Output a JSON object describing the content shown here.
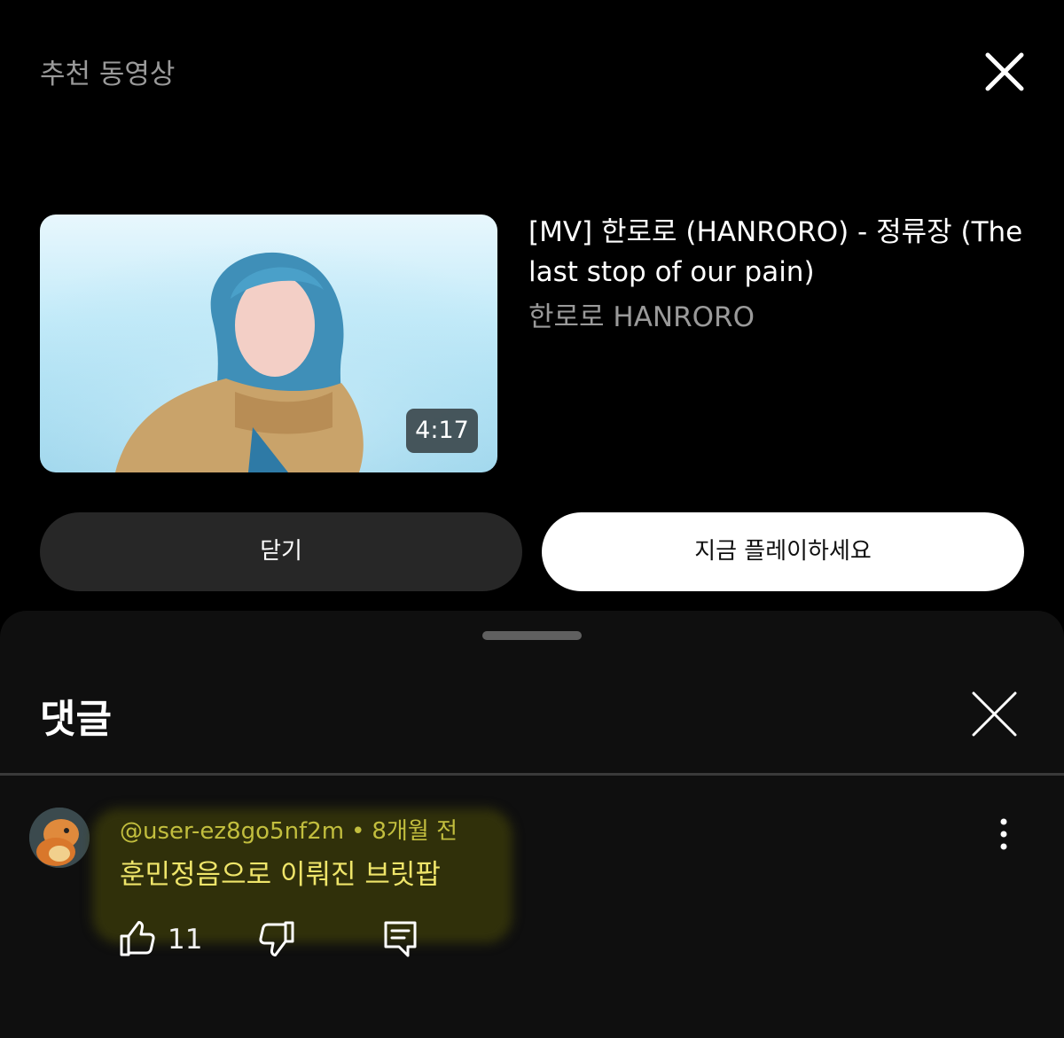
{
  "upnext": {
    "section_label": "추천 동영상",
    "close_icon": "close-icon",
    "video": {
      "title": "[MV] 한로로 (HANRORO) - 정류장 (The last stop of our pain)",
      "channel": "한로로 HANRORO",
      "duration": "4:17"
    },
    "close_button_label": "닫기",
    "play_button_label": "지금 플레이하세요"
  },
  "comments": {
    "title": "댓글",
    "close_icon": "close-icon",
    "items": [
      {
        "author": "@user-ez8go5nf2m",
        "separator": "•",
        "time": "8개월 전",
        "text": "훈민정음으로 이뤄진 브릿팝",
        "likes": "11",
        "highlight_color": "#3c3c0a"
      }
    ]
  },
  "colors": {
    "background": "#000000",
    "sheet_background": "#0f0f0f",
    "muted_text": "#9a9a9a",
    "comment_author": "#c2be3e",
    "comment_text": "#efe56a"
  }
}
